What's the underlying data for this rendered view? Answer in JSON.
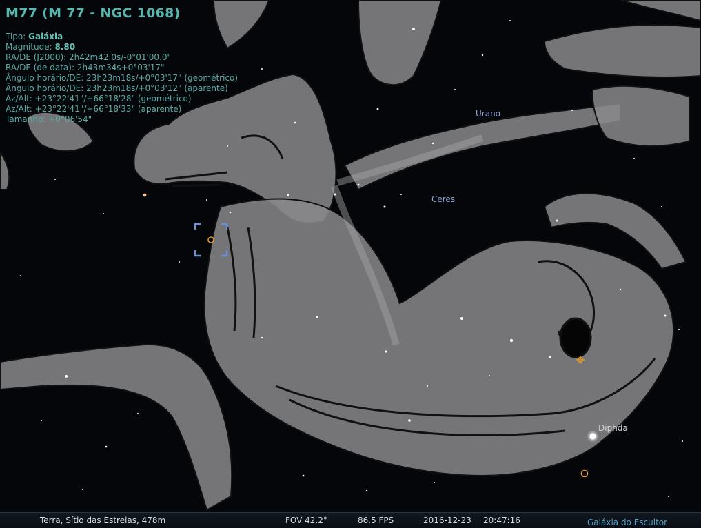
{
  "object_info": {
    "title": "M77 (M 77 - NGC 1068)",
    "type_label": "Tipo:",
    "type_value": "Galáxia",
    "magnitude_label": "Magnitude:",
    "magnitude_value": "8.80",
    "radec_j2000": "RA/DE (J2000): 2h42m42.0s/-0°01'00.0\"",
    "radec_of_date": "RA/DE (de data): 2h43m34s+0°03'17\"",
    "hour_angle_geometric": "Ângulo horário/DE: 23h23m18s/+0°03'17\" (geométrico)",
    "hour_angle_apparent": "Ângulo horário/DE: 23h23m18s/+0°03'12\" (aparente)",
    "azalt_geometric": "Az/Alt: +23°22'41\"/+66°18'28\" (geométrico)",
    "azalt_apparent": "Az/Alt: +23°22'41\"/+66°18'33\" (aparente)",
    "size": "Tamanho: +0°06'54\""
  },
  "sky_labels": {
    "uranus": "Urano",
    "ceres": "Ceres",
    "diphda": "Diphda",
    "sculptor_galaxy": "Galáxia do Escultor"
  },
  "status_bar": {
    "location": "Terra, Sítio das Estrelas, 478m",
    "fov": "FOV 42.2°",
    "fps": "86.5 FPS",
    "date": "2016-12-23",
    "time": "20:47:16"
  },
  "colors": {
    "info_text": "#58aca4",
    "planet_label": "#8da6d6",
    "star_label": "#d0d4d8",
    "selection_marker": "#6c8fd8",
    "object_marker": "#e39a2a"
  }
}
